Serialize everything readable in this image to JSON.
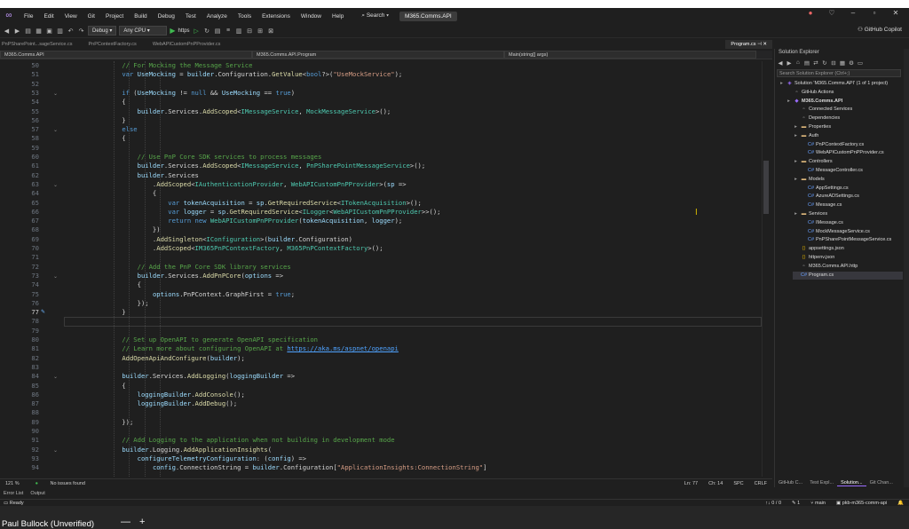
{
  "menu": {
    "items": [
      "File",
      "Edit",
      "View",
      "Git",
      "Project",
      "Build",
      "Debug",
      "Test",
      "Analyze",
      "Tools",
      "Extensions",
      "Window",
      "Help"
    ],
    "search": "Search",
    "project_name": "M365.Comms.API"
  },
  "toolbar": {
    "config": "Debug",
    "platform": "Any CPU",
    "run_target": "https",
    "copilot": "GitHub Copilot"
  },
  "tabs": {
    "open": [
      "PnPSharePoint...sageService.cs",
      "PnPContextFactory.cs",
      "WebAPICustomPnPProvider.cs"
    ],
    "active": "Program.cs"
  },
  "navbar": {
    "project": "M365.Comms.API",
    "type": "M365.Comms.API.Program",
    "member": "Main(string[] args)"
  },
  "editor": {
    "current_line": 77,
    "lines": [
      {
        "n": 50,
        "code": "    // For Mocking the Message Service"
      },
      {
        "n": 51,
        "code": "    var UseMocking = builder.Configuration.GetValue<bool?>(\"UseMockService\");"
      },
      {
        "n": 52,
        "code": ""
      },
      {
        "n": 53,
        "code": "    if (UseMocking != null && UseMocking == true)"
      },
      {
        "n": 54,
        "code": "    {"
      },
      {
        "n": 55,
        "code": "        builder.Services.AddScoped<IMessageService, MockMessageService>();"
      },
      {
        "n": 56,
        "code": "    }"
      },
      {
        "n": 57,
        "code": "    else"
      },
      {
        "n": 58,
        "code": "    {"
      },
      {
        "n": 59,
        "code": ""
      },
      {
        "n": 60,
        "code": "        // Use PnP Core SDK services to process messages"
      },
      {
        "n": 61,
        "code": "        builder.Services.AddScoped<IMessageService, PnPSharePointMessageService>();"
      },
      {
        "n": 62,
        "code": "        builder.Services"
      },
      {
        "n": 63,
        "code": "            .AddScoped<IAuthenticationProvider, WebAPICustomPnPProvider>(sp =>"
      },
      {
        "n": 64,
        "code": "            {"
      },
      {
        "n": 65,
        "code": "                var tokenAcquisition = sp.GetRequiredService<ITokenAcquisition>();"
      },
      {
        "n": 66,
        "code": "                var logger = sp.GetRequiredService<ILogger<WebAPICustomPnPProvider>>();"
      },
      {
        "n": 67,
        "code": "                return new WebAPICustomPnPProvider(tokenAcquisition, logger);"
      },
      {
        "n": 68,
        "code": "            })"
      },
      {
        "n": 69,
        "code": "            .AddSingleton<IConfiguration>(builder.Configuration)"
      },
      {
        "n": 70,
        "code": "            .AddScoped<IM365PnPContextFactory, M365PnPContextFactory>();"
      },
      {
        "n": 71,
        "code": ""
      },
      {
        "n": 72,
        "code": "        // Add the PnP Core SDK library services"
      },
      {
        "n": 73,
        "code": "        builder.Services.AddPnPCore(options =>"
      },
      {
        "n": 74,
        "code": "        {"
      },
      {
        "n": 75,
        "code": "            options.PnPContext.GraphFirst = true;"
      },
      {
        "n": 76,
        "code": "        });"
      },
      {
        "n": 77,
        "code": "    }"
      },
      {
        "n": 78,
        "code": ""
      },
      {
        "n": 79,
        "code": ""
      },
      {
        "n": 80,
        "code": "    // Set up OpenAPI to generate OpenAPI specification"
      },
      {
        "n": 81,
        "code": "    // Learn more about configuring OpenAPI at https://aka.ms/aspnet/openapi"
      },
      {
        "n": 82,
        "code": "    AddOpenApiAndConfigure(builder);"
      },
      {
        "n": 83,
        "code": ""
      },
      {
        "n": 84,
        "code": "    builder.Services.AddLogging(loggingBuilder =>"
      },
      {
        "n": 85,
        "code": "    {"
      },
      {
        "n": 86,
        "code": "        loggingBuilder.AddConsole();"
      },
      {
        "n": 87,
        "code": "        loggingBuilder.AddDebug();"
      },
      {
        "n": 88,
        "code": ""
      },
      {
        "n": 89,
        "code": "    });"
      },
      {
        "n": 90,
        "code": ""
      },
      {
        "n": 91,
        "code": "    // Add Logging to the application when not building in development mode"
      },
      {
        "n": 92,
        "code": "    builder.Logging.AddApplicationInsights("
      },
      {
        "n": 93,
        "code": "        configureTelemetryConfiguration: (config) =>"
      },
      {
        "n": 94,
        "code": "            config.ConnectionString = builder.Configuration[\"ApplicationInsights:ConnectionString\"]"
      }
    ]
  },
  "editor_status": {
    "zoom": "121 %",
    "issues": "No issues found",
    "line": "Ln: 77",
    "col": "Ch: 14",
    "spc": "SPC",
    "crlf": "CRLF"
  },
  "bottom_tabs": [
    "Error List",
    "Output"
  ],
  "solution_explorer": {
    "title": "Solution Explorer",
    "search_placeholder": "Search Solution Explorer (Ctrl+;)",
    "tree": [
      {
        "label": "Solution 'M365.Comms.API' (1 of 1 project)",
        "depth": 0,
        "icon": "sol"
      },
      {
        "label": "GitHub Actions",
        "depth": 1,
        "icon": "http"
      },
      {
        "label": "M365.Comms.API",
        "depth": 1,
        "icon": "proj"
      },
      {
        "label": "Connected Services",
        "depth": 2,
        "icon": "http"
      },
      {
        "label": "Dependencies",
        "depth": 2,
        "icon": "http"
      },
      {
        "label": "Properties",
        "depth": 2,
        "icon": "folder"
      },
      {
        "label": "Auth",
        "depth": 2,
        "icon": "folder"
      },
      {
        "label": "PnPContextFactory.cs",
        "depth": 3,
        "icon": "cs"
      },
      {
        "label": "WebAPICustomPnPProvider.cs",
        "depth": 3,
        "icon": "cs"
      },
      {
        "label": "Controllers",
        "depth": 2,
        "icon": "folder"
      },
      {
        "label": "MessageController.cs",
        "depth": 3,
        "icon": "cs"
      },
      {
        "label": "Models",
        "depth": 2,
        "icon": "folder"
      },
      {
        "label": "AppSettings.cs",
        "depth": 3,
        "icon": "cs"
      },
      {
        "label": "AzureADSettings.cs",
        "depth": 3,
        "icon": "cs"
      },
      {
        "label": "Message.cs",
        "depth": 3,
        "icon": "cs"
      },
      {
        "label": "Services",
        "depth": 2,
        "icon": "folder"
      },
      {
        "label": "IMessage.cs",
        "depth": 3,
        "icon": "cs"
      },
      {
        "label": "MockMessageService.cs",
        "depth": 3,
        "icon": "cs"
      },
      {
        "label": "PnPSharePointMessageService.cs",
        "depth": 3,
        "icon": "cs"
      },
      {
        "label": "appsettings.json",
        "depth": 2,
        "icon": "json"
      },
      {
        "label": "httpenv.json",
        "depth": 2,
        "icon": "json"
      },
      {
        "label": "M365.Comms.API.http",
        "depth": 2,
        "icon": "http"
      },
      {
        "label": "Program.cs",
        "depth": 2,
        "icon": "cs"
      }
    ],
    "tabs": [
      "GitHub C...",
      "Test Expl...",
      "Solution...",
      "Git Chan..."
    ]
  },
  "statusbar": {
    "ready": "Ready",
    "arrows": "↑↓ 0 / 0",
    "pencil": "1",
    "branch": "main",
    "repo": "pkb-m365-comm-api"
  },
  "overlay": {
    "presenter": "Paul Bullock (Unverified)"
  }
}
